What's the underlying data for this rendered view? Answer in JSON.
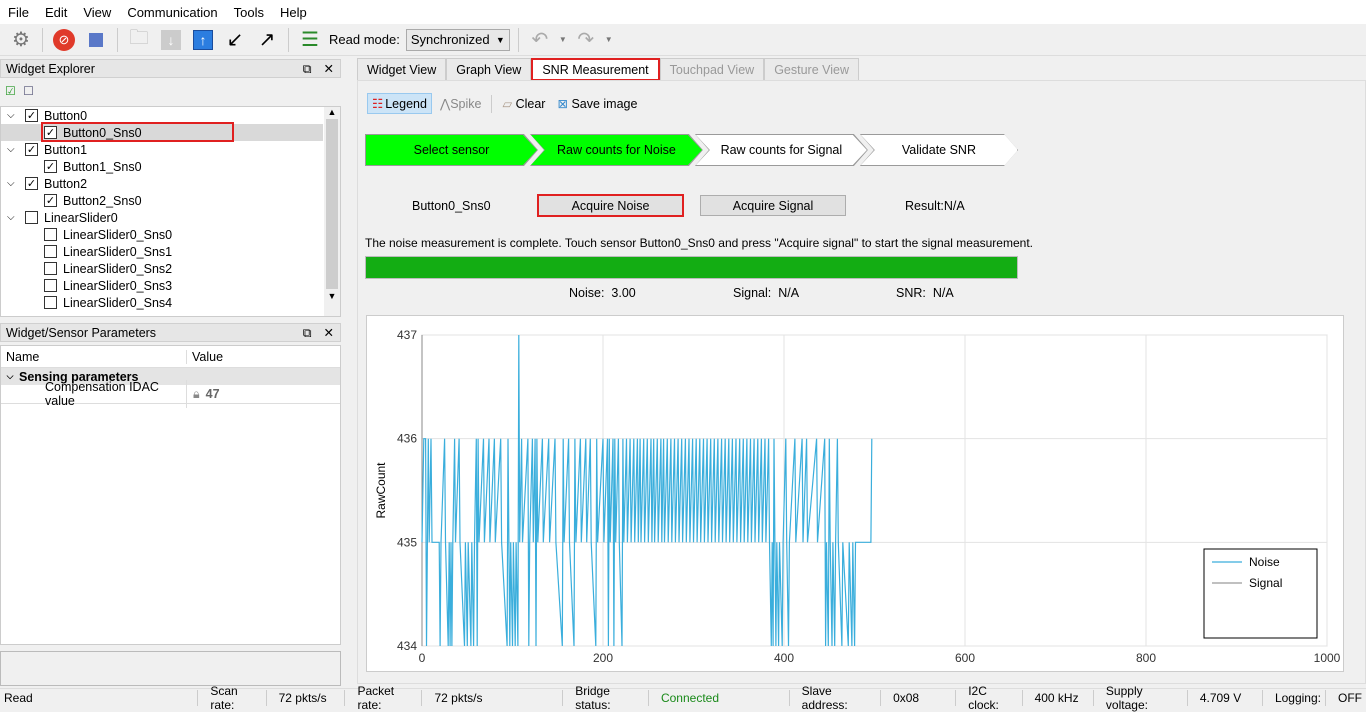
{
  "menu": [
    "File",
    "Edit",
    "View",
    "Communication",
    "Tools",
    "Help"
  ],
  "toolbar": {
    "read_mode_label": "Read mode:",
    "read_mode_value": "Synchronized"
  },
  "widget_explorer": {
    "title": "Widget Explorer",
    "items": [
      {
        "label": "Button0",
        "level": 0,
        "checked": true,
        "expanded": true
      },
      {
        "label": "Button0_Sns0",
        "level": 1,
        "checked": true,
        "selected": true
      },
      {
        "label": "Button1",
        "level": 0,
        "checked": true,
        "expanded": true
      },
      {
        "label": "Button1_Sns0",
        "level": 1,
        "checked": true
      },
      {
        "label": "Button2",
        "level": 0,
        "checked": true,
        "expanded": true
      },
      {
        "label": "Button2_Sns0",
        "level": 1,
        "checked": true
      },
      {
        "label": "LinearSlider0",
        "level": 0,
        "checked": false,
        "expanded": true
      },
      {
        "label": "LinearSlider0_Sns0",
        "level": 1,
        "checked": false
      },
      {
        "label": "LinearSlider0_Sns1",
        "level": 1,
        "checked": false
      },
      {
        "label": "LinearSlider0_Sns2",
        "level": 1,
        "checked": false
      },
      {
        "label": "LinearSlider0_Sns3",
        "level": 1,
        "checked": false
      },
      {
        "label": "LinearSlider0_Sns4",
        "level": 1,
        "checked": false
      }
    ]
  },
  "params": {
    "title": "Widget/Sensor Parameters",
    "col_name": "Name",
    "col_value": "Value",
    "group": "Sensing parameters",
    "row_name": "Compensation IDAC value",
    "row_value": "47"
  },
  "tabs": [
    {
      "label": "Widget View"
    },
    {
      "label": "Graph View"
    },
    {
      "label": "SNR Measurement",
      "active": true
    },
    {
      "label": "Touchpad View",
      "disabled": true
    },
    {
      "label": "Gesture View",
      "disabled": true
    }
  ],
  "snr_toolbar": {
    "legend": "Legend",
    "spike": "Spike",
    "clear": "Clear",
    "save": "Save image"
  },
  "steps": [
    {
      "label": "Select sensor",
      "done": true
    },
    {
      "label": "Raw counts for Noise",
      "done": true
    },
    {
      "label": "Raw counts for Signal",
      "done": false
    },
    {
      "label": "Validate SNR",
      "done": false
    }
  ],
  "sensor_name": "Button0_Sns0",
  "acquire_noise": "Acquire Noise",
  "acquire_signal": "Acquire Signal",
  "result": "Result:N/A",
  "message": "The noise measurement is complete. Touch sensor Button0_Sns0 and press \"Acquire signal\" to start the signal measurement.",
  "progress_percent": 100,
  "colors": {
    "progress": "#13ad13",
    "step_done": "#00ff00",
    "noise": "#3aaedc",
    "highlight": "#e02020"
  },
  "stats": {
    "noise_label": "Noise:",
    "noise_value": "3.00",
    "signal_label": "Signal:",
    "signal_value": "N/A",
    "snr_label": "SNR:",
    "snr_value": "N/A"
  },
  "chart_data": {
    "type": "line",
    "ylabel": "RawCount",
    "xlim": [
      0,
      1000
    ],
    "ylim": [
      434,
      437
    ],
    "xticks": [
      "0",
      "200",
      "400",
      "600",
      "800",
      "1000"
    ],
    "yticks": [
      "434",
      "435",
      "436",
      "437"
    ],
    "grid": true,
    "legend_position": "bottom-right",
    "series": [
      {
        "name": "Noise",
        "color": "#3aaedc",
        "points": [
          [
            0,
            435
          ],
          [
            2,
            436
          ],
          [
            4,
            436
          ],
          [
            5,
            434
          ],
          [
            6,
            435
          ],
          [
            7,
            436
          ],
          [
            8,
            435
          ],
          [
            10,
            436
          ],
          [
            11,
            435
          ],
          [
            19,
            435
          ],
          [
            20,
            434
          ],
          [
            21,
            435
          ],
          [
            25,
            436
          ],
          [
            26,
            435
          ],
          [
            29,
            434
          ],
          [
            30,
            435
          ],
          [
            31,
            434
          ],
          [
            32,
            435
          ],
          [
            33,
            434
          ],
          [
            34,
            435
          ],
          [
            36,
            436
          ],
          [
            37,
            435
          ],
          [
            41,
            436
          ],
          [
            42,
            435
          ],
          [
            47,
            434
          ],
          [
            48,
            435
          ],
          [
            50,
            434
          ],
          [
            51,
            435
          ],
          [
            54,
            434
          ],
          [
            55,
            435
          ],
          [
            57,
            434
          ],
          [
            58,
            435
          ],
          [
            60,
            436
          ],
          [
            61,
            434
          ],
          [
            62,
            436
          ],
          [
            63,
            435
          ],
          [
            68,
            436
          ],
          [
            69,
            435
          ],
          [
            74,
            436
          ],
          [
            75,
            435
          ],
          [
            80,
            436
          ],
          [
            81,
            435
          ],
          [
            87,
            436
          ],
          [
            88,
            435
          ],
          [
            94,
            434
          ],
          [
            95,
            436
          ],
          [
            96,
            435
          ],
          [
            97,
            434
          ],
          [
            98,
            435
          ],
          [
            100,
            434
          ],
          [
            101,
            435
          ],
          [
            103,
            434
          ],
          [
            104,
            435
          ],
          [
            106,
            434
          ],
          [
            107,
            437
          ],
          [
            108,
            435
          ],
          [
            110,
            436
          ],
          [
            111,
            435
          ],
          [
            117,
            436
          ],
          [
            118,
            434
          ],
          [
            119,
            435
          ],
          [
            122,
            436
          ],
          [
            123,
            435
          ],
          [
            125,
            436
          ],
          [
            126,
            434
          ],
          [
            127,
            436
          ],
          [
            128,
            435
          ],
          [
            133,
            436
          ],
          [
            134,
            435
          ],
          [
            140,
            436
          ],
          [
            141,
            435
          ],
          [
            147,
            436
          ],
          [
            148,
            435
          ],
          [
            155,
            434
          ],
          [
            156,
            436
          ],
          [
            157,
            435
          ],
          [
            162,
            436
          ],
          [
            163,
            435
          ],
          [
            168,
            434
          ],
          [
            169,
            436
          ],
          [
            170,
            435
          ],
          [
            175,
            436
          ],
          [
            176,
            435
          ],
          [
            181,
            436
          ],
          [
            182,
            435
          ],
          [
            186,
            436
          ],
          [
            187,
            435
          ],
          [
            192,
            434
          ],
          [
            193,
            436
          ],
          [
            194,
            435
          ],
          [
            200,
            436
          ],
          [
            201,
            435
          ],
          [
            205,
            436
          ],
          [
            206,
            434
          ],
          [
            207,
            436
          ],
          [
            208,
            435
          ],
          [
            211,
            436
          ],
          [
            212,
            434
          ],
          [
            213,
            436
          ],
          [
            214,
            435
          ],
          [
            217,
            436
          ],
          [
            218,
            435
          ],
          [
            221,
            434
          ],
          [
            222,
            436
          ],
          [
            223,
            435
          ],
          [
            226,
            436
          ],
          [
            227,
            435
          ],
          [
            230,
            436
          ],
          [
            231,
            435
          ],
          [
            234,
            436
          ],
          [
            235,
            435
          ],
          [
            238,
            436
          ],
          [
            239,
            435
          ],
          [
            241,
            436
          ],
          [
            242,
            435
          ],
          [
            245,
            436
          ],
          [
            246,
            435
          ],
          [
            249,
            436
          ],
          [
            250,
            435
          ],
          [
            253,
            436
          ],
          [
            254,
            435
          ],
          [
            256,
            436
          ],
          [
            257,
            435
          ],
          [
            260,
            436
          ],
          [
            261,
            435
          ],
          [
            264,
            436
          ],
          [
            265,
            435
          ],
          [
            267,
            436
          ],
          [
            268,
            435
          ],
          [
            271,
            436
          ],
          [
            272,
            435
          ],
          [
            275,
            436
          ],
          [
            276,
            435
          ],
          [
            279,
            436
          ],
          [
            280,
            435
          ],
          [
            283,
            436
          ],
          [
            284,
            435
          ],
          [
            287,
            436
          ],
          [
            288,
            435
          ],
          [
            291,
            436
          ],
          [
            292,
            435
          ],
          [
            295,
            436
          ],
          [
            296,
            435
          ],
          [
            299,
            436
          ],
          [
            300,
            435
          ],
          [
            303,
            436
          ],
          [
            304,
            435
          ],
          [
            307,
            436
          ],
          [
            308,
            435
          ],
          [
            311,
            436
          ],
          [
            312,
            435
          ],
          [
            315,
            436
          ],
          [
            316,
            435
          ],
          [
            319,
            436
          ],
          [
            320,
            435
          ],
          [
            323,
            436
          ],
          [
            324,
            435
          ],
          [
            327,
            436
          ],
          [
            328,
            435
          ],
          [
            331,
            436
          ],
          [
            332,
            435
          ],
          [
            335,
            436
          ],
          [
            336,
            435
          ],
          [
            339,
            436
          ],
          [
            340,
            435
          ],
          [
            343,
            436
          ],
          [
            344,
            435
          ],
          [
            347,
            436
          ],
          [
            348,
            435
          ],
          [
            351,
            436
          ],
          [
            352,
            435
          ],
          [
            355,
            436
          ],
          [
            356,
            435
          ],
          [
            359,
            436
          ],
          [
            360,
            435
          ],
          [
            363,
            436
          ],
          [
            364,
            435
          ],
          [
            367,
            436
          ],
          [
            368,
            435
          ],
          [
            371,
            436
          ],
          [
            372,
            435
          ],
          [
            375,
            436
          ],
          [
            376,
            435
          ],
          [
            379,
            436
          ],
          [
            380,
            435
          ],
          [
            383,
            436
          ],
          [
            384,
            435
          ],
          [
            386,
            434
          ],
          [
            387,
            435
          ],
          [
            388,
            434
          ],
          [
            389,
            436
          ],
          [
            390,
            435
          ],
          [
            391,
            434
          ],
          [
            392,
            435
          ],
          [
            394,
            434
          ],
          [
            395,
            435
          ],
          [
            398,
            434
          ],
          [
            399,
            435
          ],
          [
            402,
            436
          ],
          [
            403,
            435
          ],
          [
            405,
            434
          ],
          [
            406,
            435
          ],
          [
            412,
            436
          ],
          [
            413,
            435
          ],
          [
            420,
            436
          ],
          [
            421,
            435
          ],
          [
            425,
            436
          ],
          [
            426,
            435
          ],
          [
            436,
            436
          ],
          [
            437,
            435
          ],
          [
            445,
            436
          ],
          [
            446,
            434
          ],
          [
            447,
            435
          ],
          [
            449,
            434
          ],
          [
            450,
            436
          ],
          [
            451,
            435
          ],
          [
            453,
            434
          ],
          [
            454,
            435
          ],
          [
            456,
            434
          ],
          [
            457,
            435
          ],
          [
            459,
            436
          ],
          [
            460,
            435
          ],
          [
            464,
            434
          ],
          [
            465,
            435
          ],
          [
            471,
            434
          ],
          [
            472,
            435
          ],
          [
            475,
            434
          ],
          [
            476,
            435
          ],
          [
            478,
            434
          ],
          [
            479,
            435
          ],
          [
            496,
            435
          ],
          [
            497,
            436
          ]
        ]
      },
      {
        "name": "Signal",
        "color": "#9a9a9a",
        "points": []
      }
    ]
  },
  "statusbar": {
    "state": "Read",
    "scan_rate_label": "Scan rate:",
    "scan_rate": "72 pkts/s",
    "packet_rate_label": "Packet rate:",
    "packet_rate": "72 pkts/s",
    "bridge_label": "Bridge status:",
    "bridge": "Connected",
    "slave_label": "Slave address:",
    "slave": "0x08",
    "i2c_label": "I2C clock:",
    "i2c": "400 kHz",
    "supply_label": "Supply voltage:",
    "supply": "4.709 V",
    "logging_label": "Logging:",
    "logging": "OFF"
  }
}
